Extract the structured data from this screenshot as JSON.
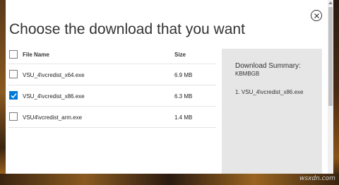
{
  "dialog": {
    "title": "Choose the download that you want"
  },
  "file_list": {
    "header": {
      "name_label": "File Name",
      "size_label": "Size"
    },
    "rows": [
      {
        "name": "VSU_4\\vcredist_x64.exe",
        "size": "6.9 MB",
        "checked": false
      },
      {
        "name": "VSU_4\\vcredist_x86.exe",
        "size": "6.3 MB",
        "checked": true
      },
      {
        "name": "VSU4\\vcredist_arm.exe",
        "size": "1.4 MB",
        "checked": false
      }
    ]
  },
  "summary": {
    "title": "Download Summary:",
    "subtitle": "KBMBGB",
    "items": [
      "1. VSU_4\\vcredist_x86.exe"
    ]
  },
  "watermark": "wsxdn.com",
  "colors": {
    "accent": "#0078d7",
    "panel": "#e6e6e6"
  }
}
